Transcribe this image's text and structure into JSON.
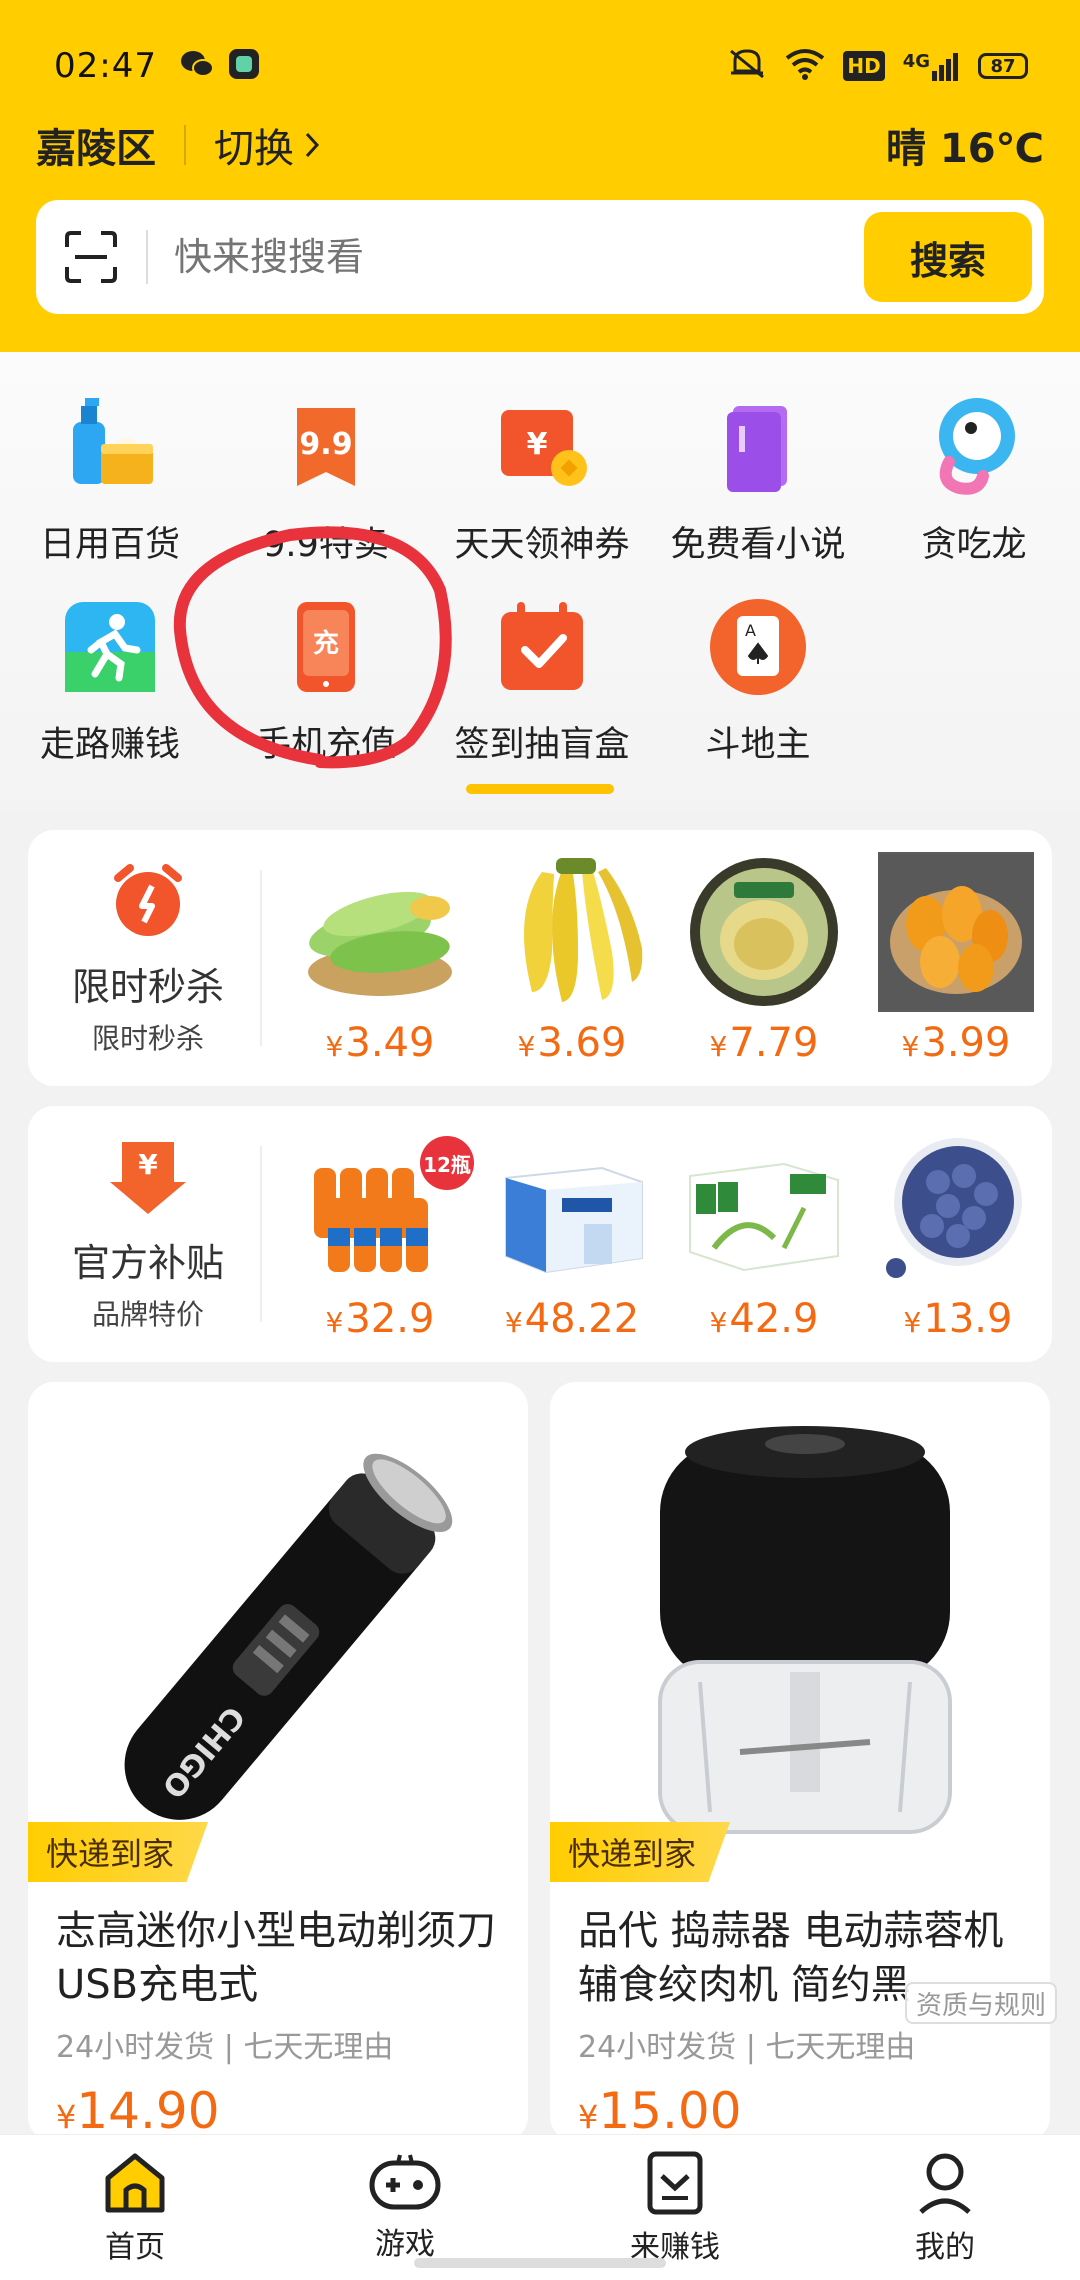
{
  "status_bar": {
    "time": "02:47",
    "battery": "87",
    "network": "4G",
    "hd": "HD"
  },
  "location": {
    "district": "嘉陵区",
    "switch_label": "切换",
    "weather": "晴 16℃"
  },
  "search": {
    "placeholder": "快来搜搜看",
    "button_label": "搜索"
  },
  "categories": [
    {
      "label": "日用百货",
      "icon": "daily-goods-icon"
    },
    {
      "label": "9.9特卖",
      "icon": "nine-nine-sale-icon",
      "icon_text": "9.9"
    },
    {
      "label": "天天领神券",
      "icon": "coupon-icon",
      "icon_text": "¥"
    },
    {
      "label": "免费看小说",
      "icon": "novel-book-icon"
    },
    {
      "label": "贪吃龙",
      "icon": "snake-game-icon"
    },
    {
      "label": "走路赚钱",
      "icon": "walking-icon"
    },
    {
      "label": "手机充值",
      "icon": "phone-recharge-icon",
      "icon_text": "充"
    },
    {
      "label": "签到抽盲盒",
      "icon": "checkin-calendar-icon"
    },
    {
      "label": "斗地主",
      "icon": "poker-card-icon",
      "icon_text": "A"
    }
  ],
  "flash_sale": {
    "title": "限时秒杀",
    "subtitle": "限时秒杀",
    "icon": "alarm-clock-icon",
    "products": [
      {
        "name": "corn",
        "price": "3.49"
      },
      {
        "name": "banana",
        "price": "3.69"
      },
      {
        "name": "durian",
        "price": "7.79"
      },
      {
        "name": "mango",
        "price": "3.99"
      }
    ]
  },
  "subsidy": {
    "title": "官方补贴",
    "subtitle": "品牌特价",
    "icon": "yen-arrow-icon",
    "badge": "12瓶",
    "products": [
      {
        "name": "orange-juice",
        "price": "32.9"
      },
      {
        "name": "milk-box-a",
        "price": "48.22"
      },
      {
        "name": "milk-box-b",
        "price": "42.9"
      },
      {
        "name": "blueberry",
        "price": "13.9"
      }
    ]
  },
  "currency": "¥",
  "feed": [
    {
      "tag": "快递到家",
      "title": "志高迷你小型电动剃须刀USB充电式",
      "meta": "24小时发货 | 七天无理由",
      "price": "14.90",
      "brand_text": "CHIGO"
    },
    {
      "tag": "快递到家",
      "title": "品代 捣蒜器 电动蒜蓉机 辅食绞肉机 简约黑",
      "meta": "24小时发货 | 七天无理由",
      "price": "15.00"
    }
  ],
  "rules_badge": "资质与规则",
  "tabs": [
    {
      "label": "首页",
      "icon": "home-icon",
      "active": true
    },
    {
      "label": "游戏",
      "icon": "gamepad-icon"
    },
    {
      "label": "来赚钱",
      "icon": "earn-money-icon"
    },
    {
      "label": "我的",
      "icon": "profile-icon"
    }
  ],
  "colors": {
    "brand": "#FFCD00",
    "price": "#F46A12",
    "annotation": "#E8323C"
  }
}
